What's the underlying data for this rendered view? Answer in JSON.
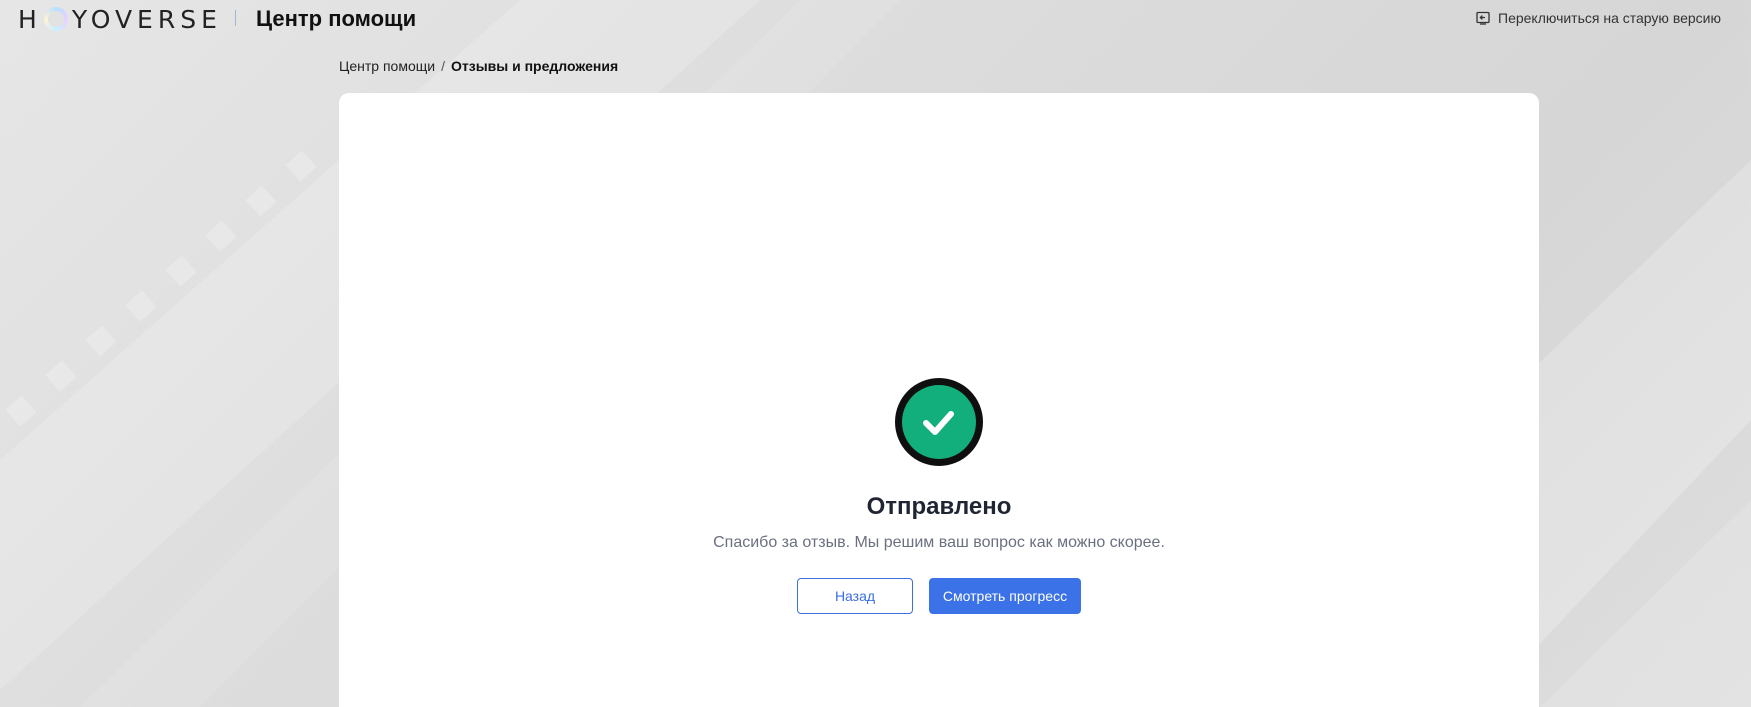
{
  "header": {
    "logo_text": "HOYOVERSE",
    "title": "Центр помощи",
    "switch_old_version_label": "Переключиться на старую версию",
    "switch_icon": "exit-to-old-version-icon"
  },
  "breadcrumb": {
    "items": [
      "Центр помощи",
      "Отзывы и предложения"
    ],
    "separator": "/"
  },
  "result": {
    "icon": "success-check-icon",
    "title": "Отправлено",
    "message": "Спасибо за отзыв. Мы решим ваш вопрос как можно скорее.",
    "back_label": "Назад",
    "progress_label": "Смотреть прогресс"
  },
  "colors": {
    "success": "#12ae7b",
    "primary": "#3b72e8",
    "background": "#dedede"
  }
}
